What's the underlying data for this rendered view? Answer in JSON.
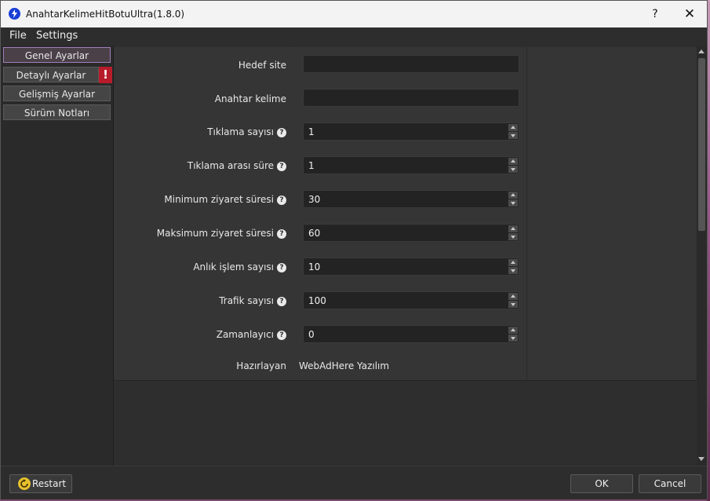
{
  "window": {
    "title": "AnahtarKelimeHitBotuUltra(1.8.0)",
    "help_label": "?",
    "close_label": "✕",
    "icon": "lightning-icon"
  },
  "menu": {
    "file": "File",
    "settings": "Settings"
  },
  "nav": {
    "items": [
      {
        "label": "Genel Ayarlar",
        "active": true
      },
      {
        "label": "Detaylı Ayarlar",
        "active": false
      },
      {
        "label": "Gelişmiş Ayarlar",
        "active": false
      },
      {
        "label": "Sürüm Notları",
        "active": false
      }
    ],
    "warning_badge": "!"
  },
  "form": {
    "rows": [
      {
        "label": "Hedef site",
        "type": "text",
        "value": "",
        "help": false
      },
      {
        "label": "Anahtar kelime",
        "type": "text",
        "value": "",
        "help": false
      },
      {
        "label": "Tıklama sayısı",
        "type": "spin",
        "value": "1",
        "help": true
      },
      {
        "label": "Tıklama arası süre",
        "type": "spin",
        "value": "1",
        "help": true
      },
      {
        "label": "Minimum ziyaret süresi",
        "type": "spin",
        "value": "30",
        "help": true
      },
      {
        "label": "Maksimum ziyaret süresi",
        "type": "spin",
        "value": "60",
        "help": true
      },
      {
        "label": "Anlık işlem sayısı",
        "type": "spin",
        "value": "10",
        "help": true
      },
      {
        "label": "Trafik sayısı",
        "type": "spin",
        "value": "100",
        "help": true
      },
      {
        "label": "Zamanlayıcı",
        "type": "spin",
        "value": "0",
        "help": true
      },
      {
        "label": "Hazırlayan",
        "type": "static",
        "value": "WebAdHere Yazılım",
        "help": false
      }
    ],
    "help_glyph": "?"
  },
  "buttons": {
    "restart": "Restart",
    "ok": "OK",
    "cancel": "Cancel"
  },
  "colors": {
    "accent": "#a17fb8",
    "warning": "#b81c2a",
    "restart_icon": "#e6c12e",
    "app_icon": "#1a3fd6"
  }
}
